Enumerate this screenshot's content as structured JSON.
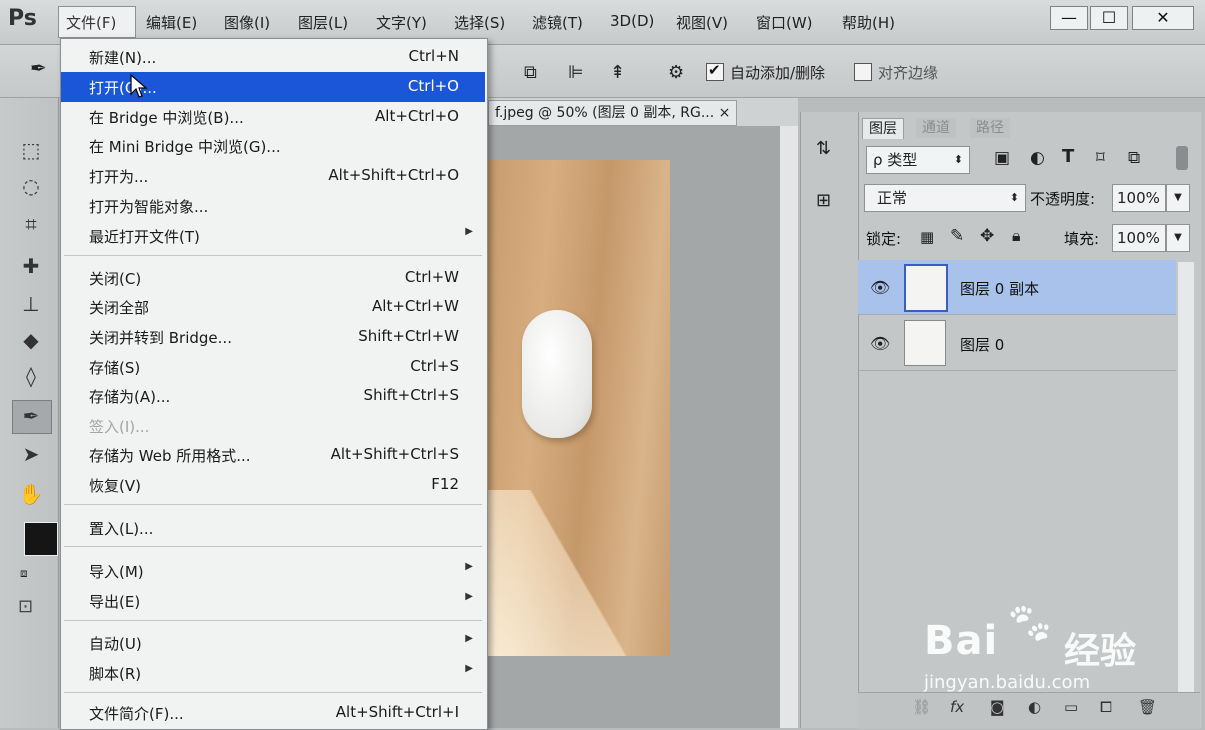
{
  "app": {
    "logo": "Ps"
  },
  "menubar": {
    "items": [
      "文件(F)",
      "编辑(E)",
      "图像(I)",
      "图层(L)",
      "文字(Y)",
      "选择(S)",
      "滤镜(T)",
      "3D(D)",
      "视图(V)",
      "窗口(W)",
      "帮助(H)"
    ],
    "window_buttons": {
      "minimize": "—",
      "maximize": "☐",
      "close": "✕"
    }
  },
  "options_bar": {
    "auto_add_delete": "自动添加/删除",
    "align_edges": "对齐边缘",
    "auto_add_checked": true,
    "align_edges_checked": false
  },
  "document": {
    "tab_title": "f.jpeg @ 50% (图层 0 副本, RG...",
    "tab_close": "×"
  },
  "file_menu": {
    "groups": [
      [
        {
          "label": "新建(N)...",
          "shortcut": "Ctrl+N"
        },
        {
          "label": "打开(O)...",
          "shortcut": "Ctrl+O",
          "highlighted": true
        },
        {
          "label": "在 Bridge 中浏览(B)...",
          "shortcut": "Alt+Ctrl+O"
        },
        {
          "label": "在 Mini Bridge 中浏览(G)...",
          "shortcut": ""
        },
        {
          "label": "打开为...",
          "shortcut": "Alt+Shift+Ctrl+O"
        },
        {
          "label": "打开为智能对象...",
          "shortcut": ""
        },
        {
          "label": "最近打开文件(T)",
          "shortcut": "",
          "submenu": true
        }
      ],
      [
        {
          "label": "关闭(C)",
          "shortcut": "Ctrl+W"
        },
        {
          "label": "关闭全部",
          "shortcut": "Alt+Ctrl+W"
        },
        {
          "label": "关闭并转到 Bridge...",
          "shortcut": "Shift+Ctrl+W"
        },
        {
          "label": "存储(S)",
          "shortcut": "Ctrl+S"
        },
        {
          "label": "存储为(A)...",
          "shortcut": "Shift+Ctrl+S"
        },
        {
          "label": "签入(I)...",
          "shortcut": "",
          "disabled": true
        },
        {
          "label": "存储为 Web 所用格式...",
          "shortcut": "Alt+Shift+Ctrl+S"
        },
        {
          "label": "恢复(V)",
          "shortcut": "F12"
        }
      ],
      [
        {
          "label": "置入(L)...",
          "shortcut": ""
        }
      ],
      [
        {
          "label": "导入(M)",
          "shortcut": "",
          "submenu": true
        },
        {
          "label": "导出(E)",
          "shortcut": "",
          "submenu": true
        }
      ],
      [
        {
          "label": "自动(U)",
          "shortcut": "",
          "submenu": true
        },
        {
          "label": "脚本(R)",
          "shortcut": "",
          "submenu": true
        }
      ],
      [
        {
          "label": "文件简介(F)...",
          "shortcut": "Alt+Shift+Ctrl+I"
        }
      ]
    ]
  },
  "layers_panel": {
    "tabs": [
      "图层",
      "通道",
      "路径"
    ],
    "filter_label": "ρ 类型",
    "blend_mode": "正常",
    "opacity_label": "不透明度:",
    "opacity_value": "100%",
    "lock_label": "锁定:",
    "fill_label": "填充:",
    "fill_value": "100%",
    "layers": [
      {
        "name": "图层 0 副本",
        "selected": true,
        "visible": true
      },
      {
        "name": "图层 0",
        "selected": false,
        "visible": true
      }
    ],
    "bottom_icons": [
      "link-icon",
      "fx-icon",
      "mask-icon",
      "adjustment-icon",
      "group-icon",
      "new-layer-icon",
      "trash-icon"
    ],
    "bottom_fx": "fx"
  },
  "watermark": {
    "brand": "Bai",
    "brand_cn": "经验",
    "url": "jingyan.baidu.com"
  }
}
